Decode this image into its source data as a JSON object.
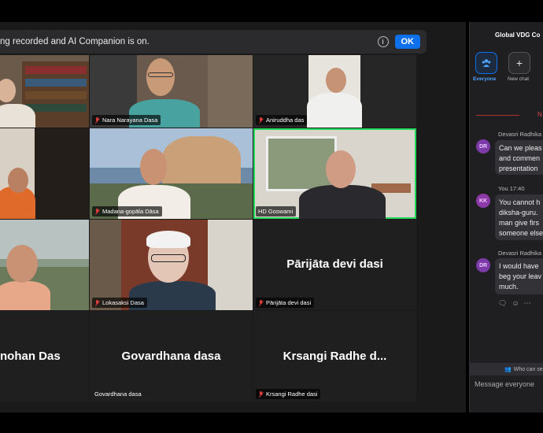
{
  "banner": {
    "text": "ng recorded and AI Companion is on.",
    "ok_label": "OK"
  },
  "tiles": [
    {
      "id": "t1",
      "name": ""
    },
    {
      "id": "t2",
      "name": "Nara Narayana Dasa",
      "muted": true
    },
    {
      "id": "t3",
      "name": "Aniruddha das",
      "muted": true
    },
    {
      "id": "t4",
      "name": ""
    },
    {
      "id": "t5",
      "name": "Madana-gopāla Dāsa",
      "muted": true
    },
    {
      "id": "t6",
      "name": "HD Goswami",
      "active": true
    },
    {
      "id": "t7",
      "name": ""
    },
    {
      "id": "t8",
      "name": "Lokasaksi Dasa",
      "muted": true
    },
    {
      "id": "t9",
      "name": "Pārijāta devi dasi",
      "muted": true,
      "big_name": "Pārijāta devi dasi"
    },
    {
      "id": "t10",
      "big_name": "nohan Das"
    },
    {
      "id": "t11",
      "name": "Govardhana dasa",
      "big_name": "Govardhana dasa"
    },
    {
      "id": "t12",
      "name": "Krsangi Radhe dasi",
      "muted": true,
      "big_name": "Krsangi  Radhe  d..."
    }
  ],
  "chat": {
    "title": "Global VDG Co",
    "everyone_label": "Everyone",
    "newchat_label": "New chat",
    "divider_tag": "N",
    "messages": [
      {
        "sender": "Devasri Radhika",
        "initials": "DR",
        "lines": [
          "Can we pleas",
          "and commen",
          "presentation"
        ]
      },
      {
        "sender": "You  17:40",
        "initials": "KK",
        "lines": [
          "You cannot h",
          "diksha-guru.",
          "man give firs",
          "someone else"
        ]
      },
      {
        "sender": "Devasri Radhika",
        "initials": "DR",
        "lines": [
          "I would have",
          "beg your leav",
          "much."
        ]
      }
    ],
    "who_can_see": "Who can se",
    "input_placeholder": "Message everyone"
  },
  "colors": {
    "accent": "#0e71eb",
    "active_speaker": "#23d959",
    "muted": "#e03b3b",
    "dr_avatar": "#7c3aa8",
    "kk_avatar": "#8c3aa8"
  }
}
